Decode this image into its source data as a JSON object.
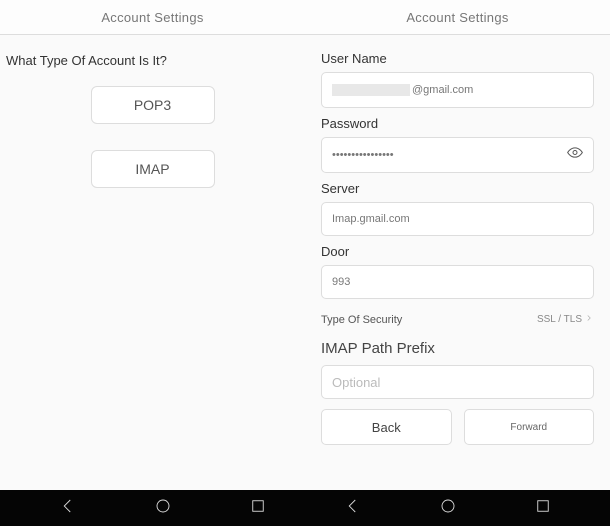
{
  "left": {
    "title": "Account Settings",
    "prompt": "What Type Of Account Is It?",
    "optionPop": "POP3",
    "optionImap": "IMAP"
  },
  "right": {
    "title": "Account Settings",
    "labels": {
      "username": "User Name",
      "password": "Password",
      "server": "Server",
      "door": "Door",
      "security": "Type Of Security",
      "prefix": "IMAP Path Prefix"
    },
    "values": {
      "usernameSuffix": "@gmail.com",
      "passwordMask": "••••••••••••••••",
      "server": "Imap.gmail.com",
      "door": "993",
      "securityValue": "SSL / TLS",
      "prefixPlaceholder": "Optional"
    },
    "actions": {
      "back": "Back",
      "forward": "Forward"
    }
  }
}
